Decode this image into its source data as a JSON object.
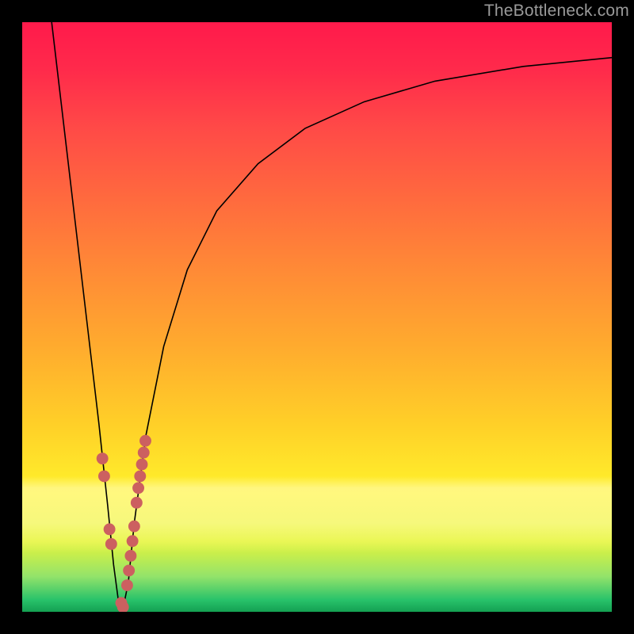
{
  "watermark": "TheBottleneck.com",
  "chart_data": {
    "type": "line",
    "title": "",
    "xlabel": "",
    "ylabel": "",
    "xlim": [
      0,
      100
    ],
    "ylim": [
      0,
      100
    ],
    "grid": false,
    "legend": false,
    "note": "Axes are unlabeled; values are read off the plot area as 0–100 percentages of width/height (0 at bottom-left).",
    "series": [
      {
        "name": "bottleneck-curve",
        "x": [
          5,
          7,
          9,
          11,
          13,
          14.5,
          15.5,
          16.3,
          17,
          18,
          19,
          21,
          24,
          28,
          33,
          40,
          48,
          58,
          70,
          85,
          100
        ],
        "y": [
          100,
          83,
          66,
          49,
          32,
          18,
          8,
          2,
          0,
          5,
          15,
          30,
          45,
          58,
          68,
          76,
          82,
          86.5,
          90,
          92.5,
          94
        ]
      }
    ],
    "minimum": {
      "x": 17,
      "y": 0
    },
    "markers": {
      "name": "highlight-dots",
      "color": "#cc6060",
      "radius_pct": 1.0,
      "points": [
        {
          "x": 13.6,
          "y": 26
        },
        {
          "x": 13.9,
          "y": 23
        },
        {
          "x": 14.8,
          "y": 14
        },
        {
          "x": 15.1,
          "y": 11.5
        },
        {
          "x": 16.8,
          "y": 1.5
        },
        {
          "x": 17.1,
          "y": 0.8
        },
        {
          "x": 19.4,
          "y": 18.5
        },
        {
          "x": 19.7,
          "y": 21
        },
        {
          "x": 20.0,
          "y": 23
        },
        {
          "x": 20.3,
          "y": 25
        },
        {
          "x": 20.6,
          "y": 27
        },
        {
          "x": 20.9,
          "y": 29
        },
        {
          "x": 17.8,
          "y": 4.5
        },
        {
          "x": 18.1,
          "y": 7
        },
        {
          "x": 18.4,
          "y": 9.5
        },
        {
          "x": 18.7,
          "y": 12
        },
        {
          "x": 19.0,
          "y": 14.5
        }
      ]
    },
    "background_gradient": {
      "type": "vertical",
      "stops": [
        {
          "pct": 0,
          "color": "#ff1a4b"
        },
        {
          "pct": 30,
          "color": "#ff6a3e"
        },
        {
          "pct": 55,
          "color": "#ffab2e"
        },
        {
          "pct": 80,
          "color": "#fff22b"
        },
        {
          "pct": 94,
          "color": "#93e36a"
        },
        {
          "pct": 100,
          "color": "#14a052"
        }
      ]
    }
  }
}
